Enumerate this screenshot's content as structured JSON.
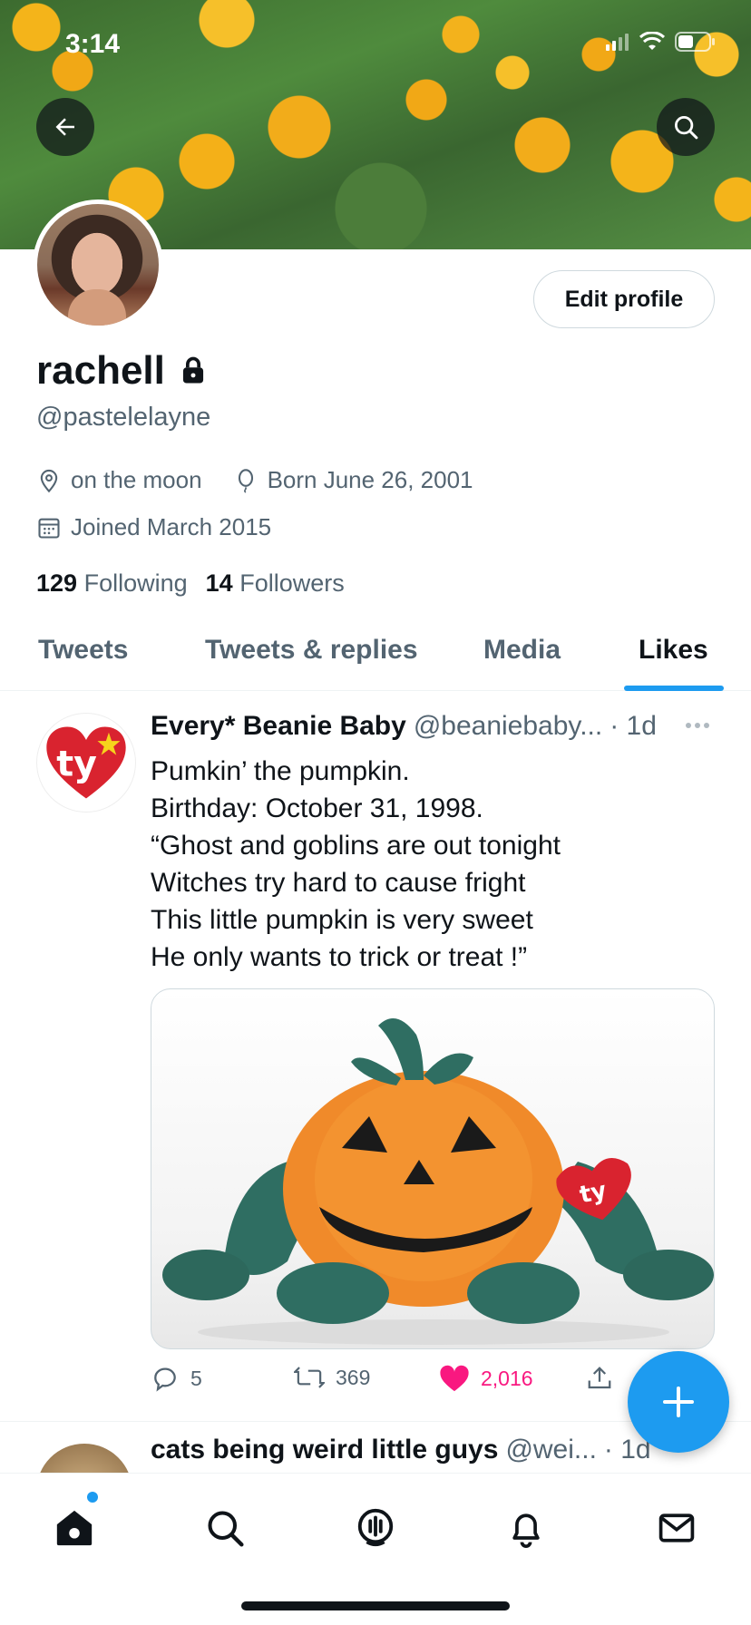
{
  "status_bar": {
    "time": "3:14"
  },
  "profile": {
    "display_name": "rachell",
    "handle": "@pastelelayne",
    "location": "on the moon",
    "birthday": "Born June 26, 2001",
    "joined": "Joined March 2015",
    "following_count": "129",
    "following_label": "Following",
    "followers_count": "14",
    "followers_label": "Followers",
    "edit_profile_label": "Edit profile",
    "locked": true
  },
  "tabs": [
    {
      "label": "Tweets",
      "active": false
    },
    {
      "label": "Tweets & replies",
      "active": false
    },
    {
      "label": "Media",
      "active": false
    },
    {
      "label": "Likes",
      "active": true
    }
  ],
  "tweets": [
    {
      "author_name": "Every* Beanie Baby",
      "author_handle": "@beaniebaby...",
      "time": "· 1d",
      "text_lines": [
        "Pumkin’ the pumpkin.",
        "Birthday: October 31, 1998.",
        "“Ghost and goblins are out tonight",
        "Witches try hard to cause fright",
        "This little pumpkin is very sweet",
        "He only wants to trick or treat !”"
      ],
      "avatar_text": "ty",
      "replies": "5",
      "retweets": "369",
      "likes": "2,016",
      "liked": true,
      "media_tag_text": "ty"
    },
    {
      "author_name": "cats being weird little guys",
      "author_handle": "@wei...",
      "time": "· 1d"
    }
  ],
  "colors": {
    "accent": "#1d9bf0",
    "like": "#f91880",
    "text_primary": "#0f1419",
    "text_secondary": "#536471",
    "pumpkin_orange": "#f08a2a",
    "plush_green": "#2f6e62"
  },
  "icons": {
    "back": "arrow-left-icon",
    "search": "search-icon",
    "lock": "lock-icon",
    "location": "location-pin-icon",
    "birthday": "balloon-icon",
    "calendar": "calendar-icon",
    "more": "more-dots-icon",
    "reply": "reply-icon",
    "retweet": "retweet-icon",
    "like": "heart-icon",
    "share": "share-icon",
    "compose": "plus-icon",
    "nav": [
      "home-icon",
      "search-icon",
      "spaces-icon",
      "bell-icon",
      "mail-icon"
    ]
  }
}
